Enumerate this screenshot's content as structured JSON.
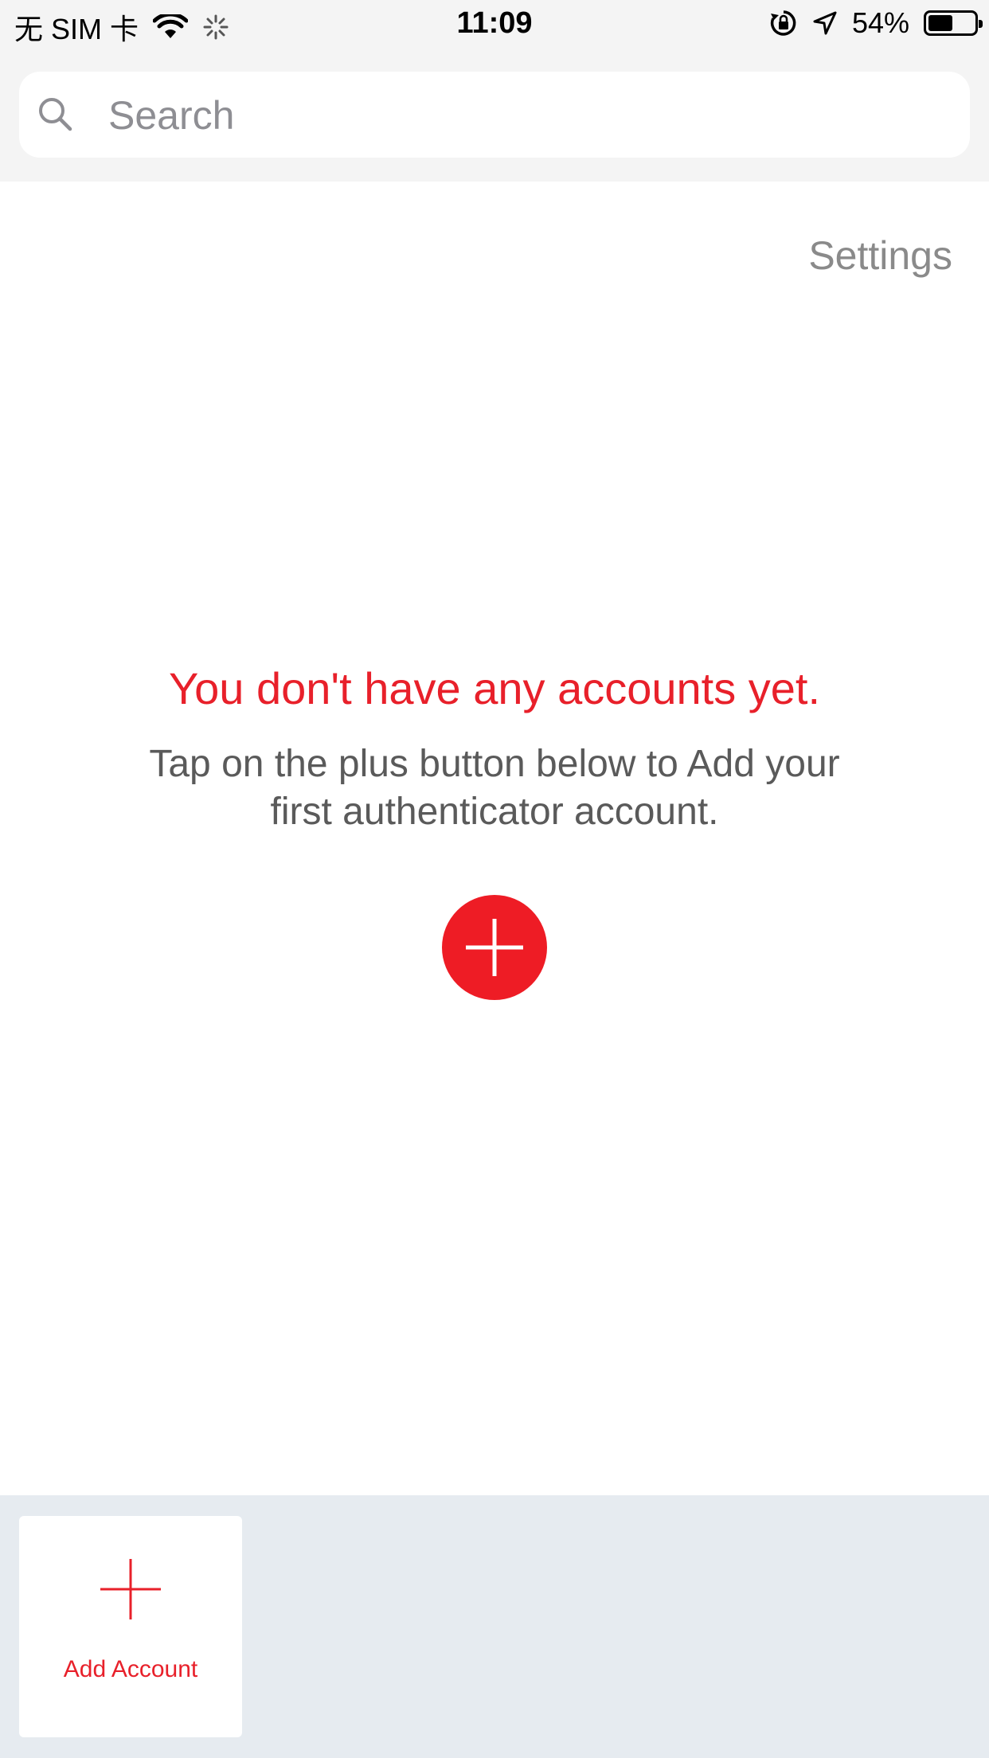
{
  "status_bar": {
    "carrier": "无 SIM 卡",
    "time": "11:09",
    "battery_percent_label": "54%",
    "battery_level": 0.54,
    "icons": [
      "wifi-icon",
      "loading-spinner-icon",
      "orientation-lock-icon",
      "location-icon",
      "battery-icon"
    ]
  },
  "search": {
    "placeholder": "Search"
  },
  "header": {
    "settings_label": "Settings"
  },
  "empty_state": {
    "title": "You don't have any accounts yet.",
    "description": "Tap on the plus button below to Add your first authenticator account."
  },
  "bottom_bar": {
    "add_account_label": "Add Account"
  },
  "colors": {
    "accent_red": "#e8202a",
    "plus_button_red": "#ee1c25",
    "bottom_bar_bg": "#e6ebf0",
    "header_bg": "#f4f4f4"
  }
}
